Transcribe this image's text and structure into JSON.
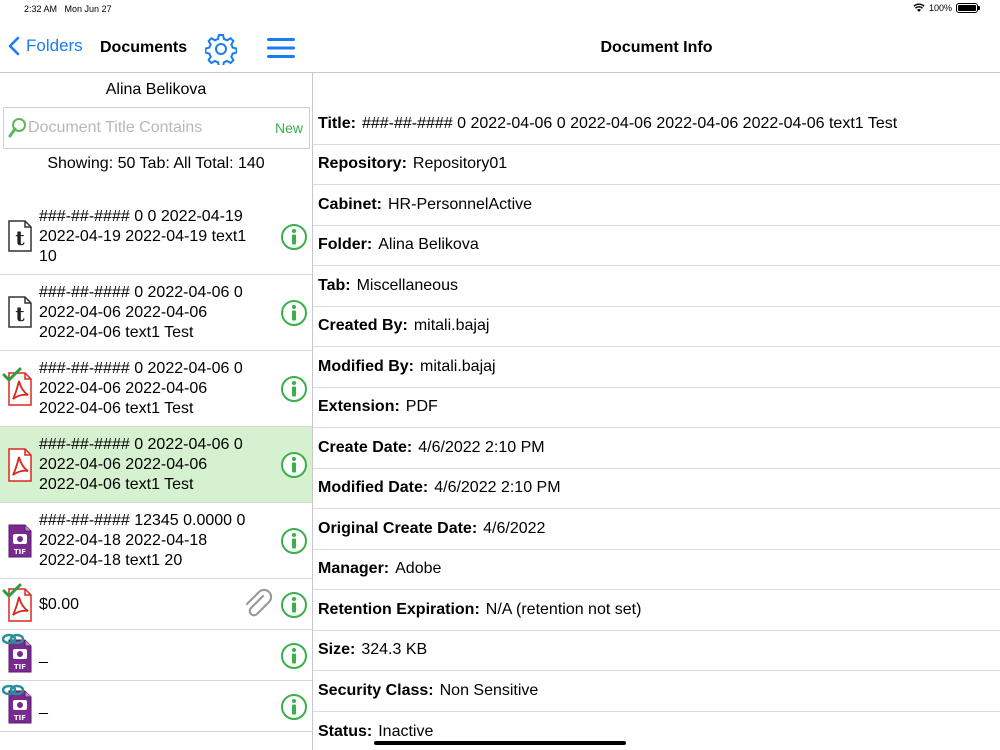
{
  "status": {
    "time": "2:32 AM",
    "date": "Mon Jun 27",
    "battery": "100%",
    "battery_level": 1.0
  },
  "nav": {
    "back_label": "Folders",
    "left_title": "Documents",
    "right_title": "Document Info"
  },
  "left": {
    "user": "Alina Belikova",
    "search_placeholder": "Document Title Contains",
    "new_label": "New",
    "showing": "Showing: 50 Tab: All Total: 140",
    "items": [
      {
        "icon": "text-file-icon",
        "lines": [
          "###-##-#### 0 0 2022-04-19",
          "2022-04-19 2022-04-19 text1",
          "10"
        ],
        "selected": false,
        "checked": false,
        "attachment": false
      },
      {
        "icon": "text-file-icon",
        "lines": [
          "###-##-#### 0 2022-04-06 0",
          "2022-04-06 2022-04-06",
          "2022-04-06 text1 Test"
        ],
        "selected": false,
        "checked": false,
        "attachment": false
      },
      {
        "icon": "pdf-file-icon",
        "lines": [
          "###-##-#### 0 2022-04-06 0",
          "2022-04-06 2022-04-06",
          "2022-04-06 text1 Test"
        ],
        "selected": false,
        "checked": true,
        "attachment": false
      },
      {
        "icon": "pdf-file-icon",
        "lines": [
          "###-##-#### 0 2022-04-06 0",
          "2022-04-06 2022-04-06",
          "2022-04-06 text1 Test"
        ],
        "selected": true,
        "checked": false,
        "attachment": false
      },
      {
        "icon": "tif-file-icon",
        "lines": [
          "###-##-#### 12345 0.0000 0",
          "2022-04-18 2022-04-18",
          "2022-04-18 text1 20"
        ],
        "selected": false,
        "checked": false,
        "attachment": false
      },
      {
        "icon": "pdf-file-icon",
        "lines": [
          "$0.00"
        ],
        "selected": false,
        "checked": true,
        "attachment": true
      },
      {
        "icon": "tif-file-icon",
        "lines": [
          "_"
        ],
        "selected": false,
        "checked": false,
        "attachment": false,
        "linked": true
      },
      {
        "icon": "tif-file-icon",
        "lines": [
          "_"
        ],
        "selected": false,
        "checked": false,
        "attachment": false,
        "linked": true
      }
    ]
  },
  "fields": [
    {
      "label": "Title:",
      "value": "###-##-#### 0 2022-04-06 0 2022-04-06 2022-04-06 2022-04-06 text1 Test"
    },
    {
      "label": "Repository:",
      "value": "Repository01"
    },
    {
      "label": "Cabinet:",
      "value": "HR-PersonnelActive"
    },
    {
      "label": "Folder:",
      "value": "Alina Belikova"
    },
    {
      "label": "Tab:",
      "value": "Miscellaneous"
    },
    {
      "label": "Created By:",
      "value": "mitali.bajaj"
    },
    {
      "label": "Modified By:",
      "value": "mitali.bajaj"
    },
    {
      "label": "Extension:",
      "value": "PDF"
    },
    {
      "label": "Create Date:",
      "value": "4/6/2022 2:10 PM"
    },
    {
      "label": "Modified Date:",
      "value": "4/6/2022 2:10 PM"
    },
    {
      "label": "Original Create Date:",
      "value": "4/6/2022"
    },
    {
      "label": "Manager:",
      "value": "Adobe"
    },
    {
      "label": "Retention Expiration:",
      "value": "N/A (retention not set)"
    },
    {
      "label": "Size:",
      "value": "324.3 KB"
    },
    {
      "label": "Security Class:",
      "value": "Non Sensitive"
    },
    {
      "label": "Status:",
      "value": "Inactive"
    }
  ],
  "colors": {
    "accent": "#1a7cf3",
    "green": "#39b04a",
    "selected_row": "#d6f1cf",
    "pdf_red": "#d9281e",
    "tif_purple": "#7a2a8f"
  }
}
